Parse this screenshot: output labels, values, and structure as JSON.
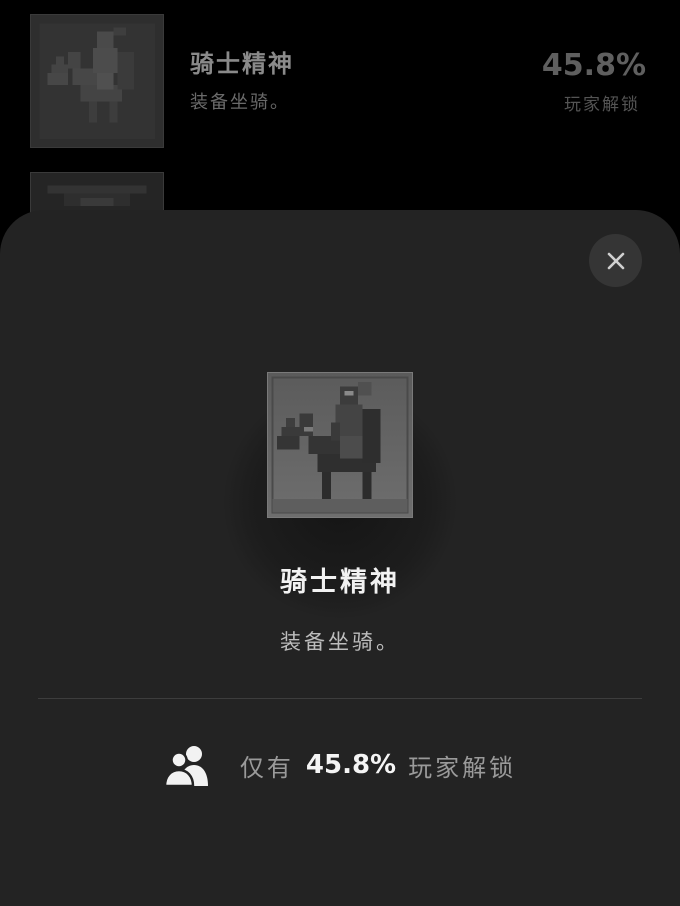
{
  "list": {
    "items": [
      {
        "title": "骑士精神",
        "description": "装备坐骑。",
        "percent": "45.8%",
        "percent_label": "玩家解锁",
        "icon": "knight-on-horse-icon"
      },
      {
        "title": "",
        "icon": "ornate-frame-icon"
      }
    ]
  },
  "sheet": {
    "close_icon": "close-icon",
    "icon": "knight-on-horse-icon",
    "title": "骑士精神",
    "description": "装备坐骑。",
    "stats": {
      "icon": "users-icon",
      "prefix": "仅有",
      "percent": "45.8%",
      "suffix": "玩家解锁"
    }
  }
}
